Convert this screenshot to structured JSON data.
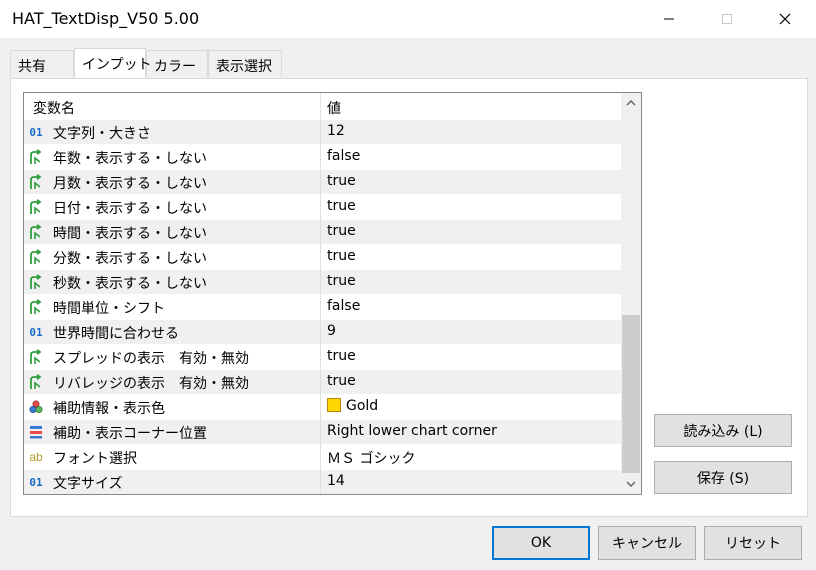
{
  "window": {
    "title": "HAT_TextDisp_V50 5.00",
    "minimize_icon": "minimize-icon",
    "maximize_icon": "maximize-icon",
    "close_icon": "close-icon"
  },
  "tabs": [
    {
      "label": "共有",
      "active": false
    },
    {
      "label": "インプット",
      "active": true
    },
    {
      "label": "カラー",
      "active": false
    },
    {
      "label": "表示選択",
      "active": false
    }
  ],
  "grid": {
    "columns": {
      "name": "変数名",
      "value": "値"
    },
    "rows": [
      {
        "icon": "int",
        "name": "文字列・大きさ",
        "value": "12"
      },
      {
        "icon": "bool",
        "name": "年数・表示する・しない",
        "value": "false"
      },
      {
        "icon": "bool",
        "name": "月数・表示する・しない",
        "value": "true"
      },
      {
        "icon": "bool",
        "name": "日付・表示する・しない",
        "value": "true"
      },
      {
        "icon": "bool",
        "name": "時間・表示する・しない",
        "value": "true"
      },
      {
        "icon": "bool",
        "name": "分数・表示する・しない",
        "value": "true"
      },
      {
        "icon": "bool",
        "name": "秒数・表示する・しない",
        "value": "true"
      },
      {
        "icon": "bool",
        "name": "時間単位・シフト",
        "value": "false"
      },
      {
        "icon": "int",
        "name": "世界時間に合わせる",
        "value": "9"
      },
      {
        "icon": "bool",
        "name": "スプレッドの表示　有効・無効",
        "value": "true"
      },
      {
        "icon": "bool",
        "name": "リバレッジの表示　有効・無効",
        "value": "true"
      },
      {
        "icon": "color",
        "name": "補助情報・表示色",
        "value": "Gold",
        "swatch": "#ffd700"
      },
      {
        "icon": "enum",
        "name": "補助・表示コーナー位置",
        "value": "Right lower chart corner"
      },
      {
        "icon": "string",
        "name": "フォント選択",
        "value": "ＭＳ ゴシック"
      },
      {
        "icon": "int",
        "name": "文字サイズ",
        "value": "14"
      }
    ],
    "icon_labels": {
      "int": "01",
      "string": "ab"
    },
    "scroll": {
      "thumb_position": "bottom"
    }
  },
  "buttons": {
    "load": "読み込み (L)",
    "save": "保存 (S)",
    "ok": "OK",
    "cancel": "キャンセル",
    "reset": "リセット"
  },
  "colors": {
    "ok_border": "#0078d7",
    "bool_icon": "#2e9e3e",
    "int_icon": "#1a6bc4",
    "gold": "#ffd700"
  }
}
